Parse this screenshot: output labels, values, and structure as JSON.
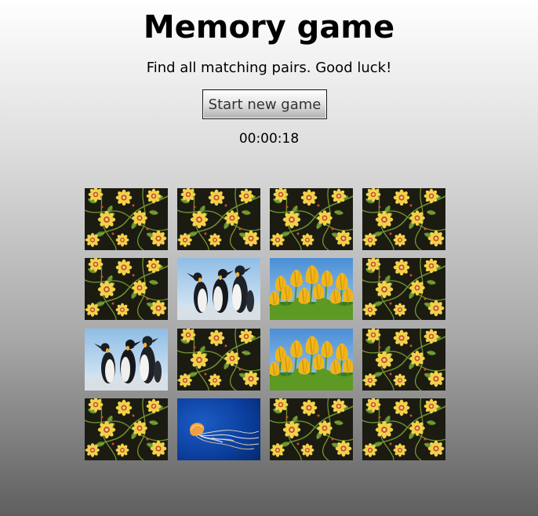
{
  "header": {
    "title": "Memory game",
    "subtitle": "Find all matching pairs. Good luck!",
    "new_game_label": "Start new game",
    "timer": "00:00:18"
  },
  "colors": {
    "card_back_bg": "#1b1b12",
    "flower_petal": "#f2d24a",
    "flower_center": "#c8502c",
    "leaf": "#5f8a2a",
    "sky": "#8fbde6",
    "tulip": "#f0b619",
    "ocean": "#0b3f9e"
  },
  "board": {
    "rows": 4,
    "columns": 4,
    "cards": [
      {
        "state": "hidden",
        "image": "floral-card-back"
      },
      {
        "state": "hidden",
        "image": "floral-card-back"
      },
      {
        "state": "hidden",
        "image": "floral-card-back"
      },
      {
        "state": "hidden",
        "image": "floral-card-back"
      },
      {
        "state": "hidden",
        "image": "floral-card-back"
      },
      {
        "state": "revealed",
        "image": "penguins"
      },
      {
        "state": "revealed",
        "image": "tulips"
      },
      {
        "state": "hidden",
        "image": "floral-card-back"
      },
      {
        "state": "revealed",
        "image": "penguins"
      },
      {
        "state": "hidden",
        "image": "floral-card-back"
      },
      {
        "state": "revealed",
        "image": "tulips"
      },
      {
        "state": "hidden",
        "image": "floral-card-back"
      },
      {
        "state": "hidden",
        "image": "floral-card-back"
      },
      {
        "state": "revealed",
        "image": "jellyfish"
      },
      {
        "state": "hidden",
        "image": "floral-card-back"
      },
      {
        "state": "hidden",
        "image": "floral-card-back"
      }
    ]
  }
}
